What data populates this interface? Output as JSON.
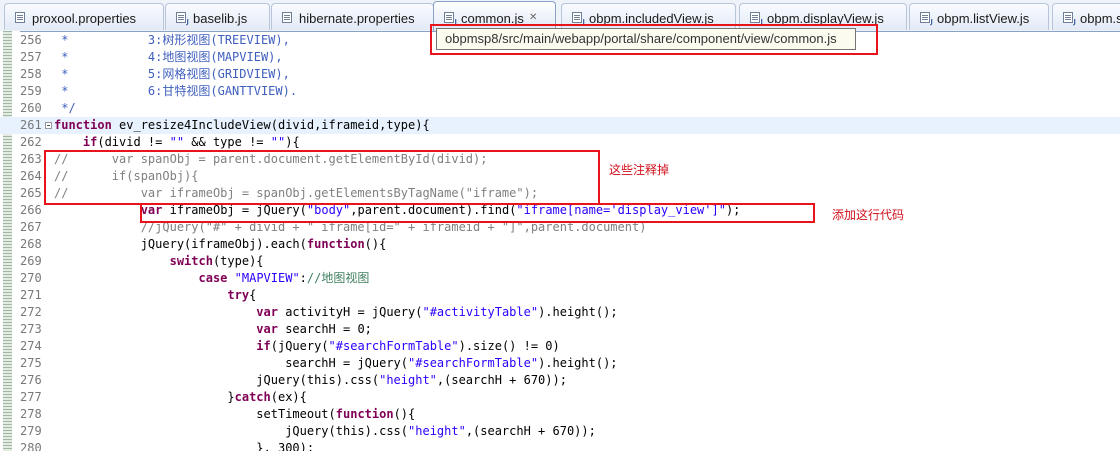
{
  "tabs": [
    {
      "label": "proxool.properties",
      "icon": "properties-file-icon",
      "active": false
    },
    {
      "label": "baselib.js",
      "icon": "javascript-file-icon",
      "active": false
    },
    {
      "label": "hibernate.properties",
      "icon": "properties-file-icon",
      "active": false
    },
    {
      "label": "common.js",
      "icon": "javascript-file-icon",
      "active": true,
      "close": "✕"
    },
    {
      "label": "obpm.includedView.js",
      "icon": "javascript-file-icon",
      "active": false
    },
    {
      "label": "obpm.displayView.js",
      "icon": "javascript-file-icon",
      "active": false
    },
    {
      "label": "obpm.listView.js",
      "icon": "javascript-file-icon",
      "active": false
    },
    {
      "label": "obpm.su",
      "icon": "javascript-file-icon",
      "active": false
    }
  ],
  "tooltip": "obpmsp8/src/main/webapp/portal/share/component/view/common.js",
  "annotations": {
    "comment_out": "这些注释掉",
    "add_line": "添加这行代码"
  },
  "colors": {
    "keyword": "#7f0055",
    "string": "#2a00ff",
    "comment": "#3f7f5f",
    "javadoc": "#3f5fbf",
    "annotation_red": "#e8131b"
  },
  "editor": {
    "current_line": "261",
    "lines": [
      {
        "no": "256",
        "text": " *           3:树形视图(TREEVIEW),"
      },
      {
        "no": "257",
        "text": " *           4:地图视图(MAPVIEW),"
      },
      {
        "no": "258",
        "text": " *           5:网格视图(GRIDVIEW),"
      },
      {
        "no": "259",
        "text": " *           6:甘特视图(GANTTVIEW)."
      },
      {
        "no": "260",
        "text": " */"
      },
      {
        "no": "261",
        "text": "function ev_resize4IncludeView(divid,iframeid,type){"
      },
      {
        "no": "262",
        "text": "    if(divid != \"\" && type != \"\"){"
      },
      {
        "no": "263",
        "text": "//      var spanObj = parent.document.getElementById(divid);"
      },
      {
        "no": "264",
        "text": "//      if(spanObj){"
      },
      {
        "no": "265",
        "text": "//          var iframeObj = spanObj.getElementsByTagName(\"iframe\");"
      },
      {
        "no": "266",
        "text": "            var iframeObj = jQuery(\"body\",parent.document).find(\"iframe[name='display_view']\");"
      },
      {
        "no": "267",
        "text": "            //jQuery(\"#\" + divid + \" iframe[id=\" + iframeid + \"]\",parent.document)"
      },
      {
        "no": "268",
        "text": "            jQuery(iframeObj).each(function(){"
      },
      {
        "no": "269",
        "text": "                switch(type){"
      },
      {
        "no": "270",
        "text": "                    case \"MAPVIEW\"://地图视图"
      },
      {
        "no": "271",
        "text": "                        try{"
      },
      {
        "no": "272",
        "text": "                            var activityH = jQuery(\"#activityTable\").height();"
      },
      {
        "no": "273",
        "text": "                            var searchH = 0;"
      },
      {
        "no": "274",
        "text": "                            if(jQuery(\"#searchFormTable\").size() != 0)"
      },
      {
        "no": "275",
        "text": "                                searchH = jQuery(\"#searchFormTable\").height();"
      },
      {
        "no": "276",
        "text": "                            jQuery(this).css(\"height\",(searchH + 670));"
      },
      {
        "no": "277",
        "text": "                        }catch(ex){"
      },
      {
        "no": "278",
        "text": "                            setTimeout(function(){"
      },
      {
        "no": "279",
        "text": "                                jQuery(this).css(\"height\",(searchH + 670));"
      },
      {
        "no": "280",
        "text": "                            }, 300);"
      }
    ]
  }
}
